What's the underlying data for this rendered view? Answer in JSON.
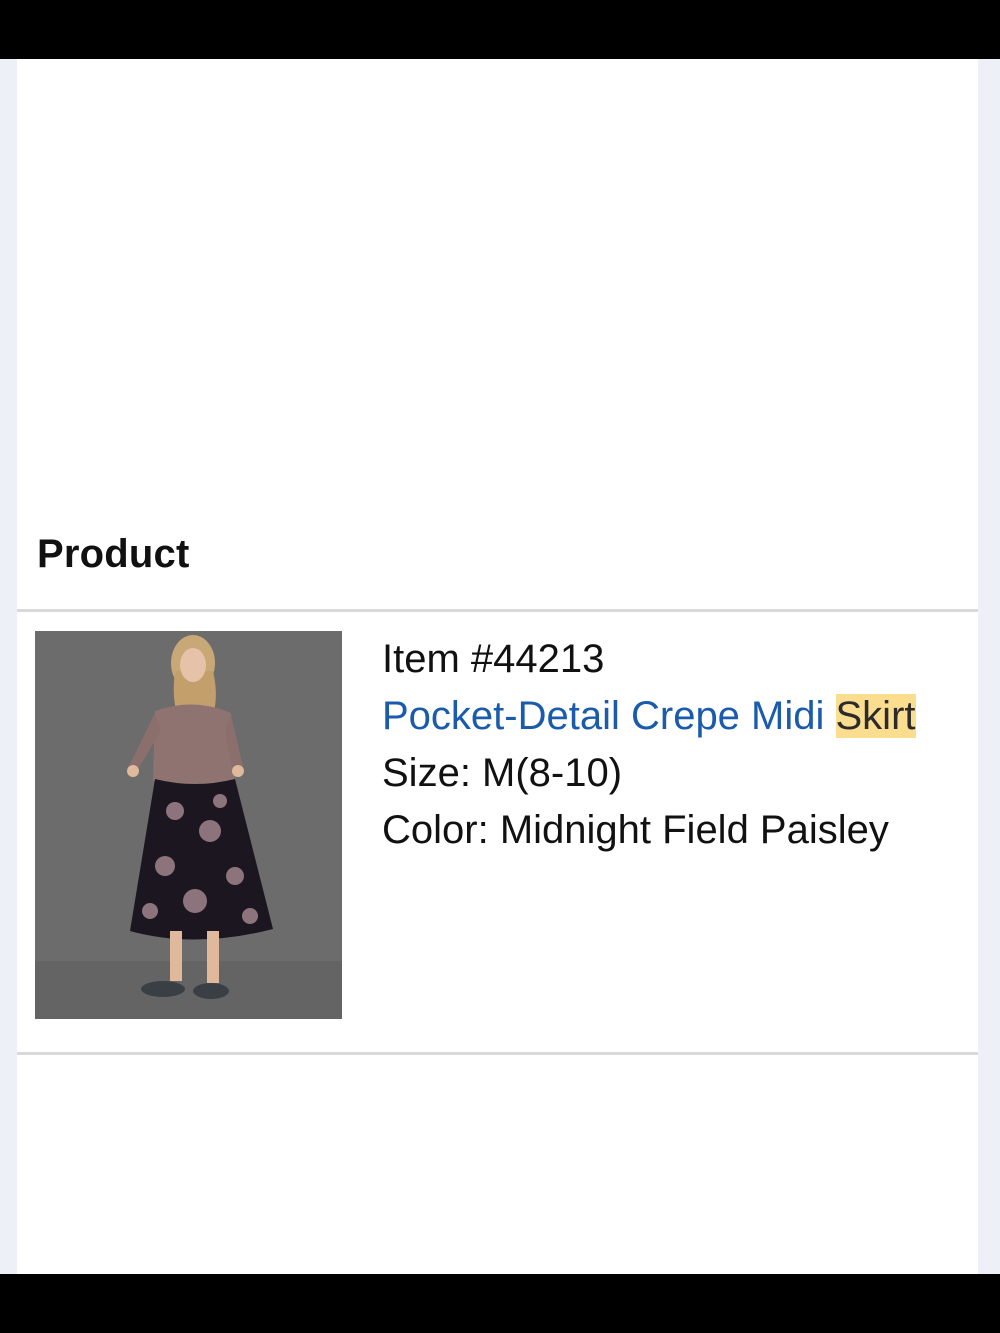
{
  "product_section": {
    "title": "Product",
    "item_number": "Item #44213",
    "name_main": "Pocket-Detail Crepe Midi ",
    "name_highlight": "Skirt",
    "size": "Size: M(8-10)",
    "color": "Color: Midnight Field Paisley"
  },
  "colors": {
    "link": "#1a5bab",
    "highlight": "#fbdd8f",
    "divider": "#d9d9d9"
  }
}
